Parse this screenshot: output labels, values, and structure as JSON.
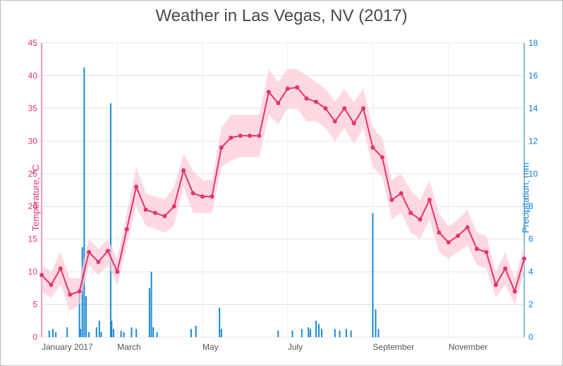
{
  "chart_data": {
    "type": "line+bar",
    "title": "Weather in Las Vegas, NV (2017)",
    "xlabel": "",
    "y_left_label": "Temperature, °C",
    "y_right_label": "Precipitation, mm",
    "y_left": {
      "min": 0,
      "max": 45,
      "step": 5,
      "color": "#e6326e"
    },
    "y_right": {
      "min": 0,
      "max": 18,
      "step": 2,
      "color": "#0f7bd1"
    },
    "x_ticks": [
      "January 2017",
      "March",
      "May",
      "July",
      "September",
      "November"
    ],
    "x_tick_week_index": [
      0,
      8,
      17,
      26,
      35,
      43
    ],
    "temperature_weekly": {
      "avg": [
        9.5,
        8.0,
        10.5,
        6.5,
        7.0,
        13.0,
        11.5,
        13.2,
        10.0,
        16.5,
        23.0,
        19.5,
        19.0,
        18.5,
        20.0,
        25.5,
        22.0,
        21.5,
        21.5,
        29.0,
        30.5,
        30.8,
        30.8,
        30.8,
        37.5,
        35.8,
        38.0,
        38.2,
        36.5,
        36.0,
        35.0,
        33.0,
        35.0,
        32.7,
        35.0,
        29.0,
        27.5,
        21.0,
        22.0,
        19.0,
        18.0,
        21.0,
        16.0,
        14.5,
        15.5,
        16.8,
        13.5,
        13.0,
        8.0,
        10.5,
        7.0,
        12.0
      ],
      "high": [
        11,
        10,
        13,
        9,
        9,
        15,
        13.5,
        15,
        12,
        19,
        26,
        22,
        21.5,
        21,
        23,
        28,
        25.5,
        24,
        24,
        32,
        34,
        34,
        34,
        34,
        41,
        39,
        41,
        41,
        40,
        39,
        38,
        36,
        38,
        36,
        38,
        32,
        30.5,
        24,
        25,
        22.5,
        21,
        24,
        19,
        17,
        18,
        19.5,
        16,
        15.5,
        10,
        13,
        9,
        14
      ],
      "low": [
        7,
        6,
        8,
        4,
        5,
        11,
        9.5,
        11,
        8,
        14,
        20,
        17,
        16.5,
        16,
        17,
        23,
        19,
        19,
        19,
        26,
        27,
        27.5,
        27.5,
        27.5,
        34,
        32.5,
        35,
        35,
        33,
        33,
        32,
        30,
        32,
        29.5,
        32,
        26,
        24.5,
        18,
        19,
        16,
        15,
        18,
        13,
        12,
        13,
        14,
        11,
        10.5,
        6,
        8,
        5,
        10
      ]
    },
    "precipitation_events": [
      [
        0.8,
        0.4
      ],
      [
        1.2,
        0.5
      ],
      [
        1.5,
        0.3
      ],
      [
        2.7,
        0.6
      ],
      [
        4.0,
        3.0
      ],
      [
        4.1,
        0.5
      ],
      [
        4.3,
        5.5
      ],
      [
        4.5,
        16.5
      ],
      [
        4.7,
        2.5
      ],
      [
        5.0,
        0.3
      ],
      [
        5.8,
        0.6
      ],
      [
        6.1,
        1.0
      ],
      [
        6.3,
        0.3
      ],
      [
        7.3,
        14.3
      ],
      [
        7.4,
        1.0
      ],
      [
        7.6,
        0.5
      ],
      [
        8.4,
        0.4
      ],
      [
        8.7,
        0.3
      ],
      [
        9.5,
        0.6
      ],
      [
        10.0,
        0.5
      ],
      [
        11.4,
        3.0
      ],
      [
        11.6,
        4.0
      ],
      [
        11.8,
        0.6
      ],
      [
        12.2,
        0.3
      ],
      [
        15.8,
        0.5
      ],
      [
        16.3,
        0.7
      ],
      [
        18.8,
        1.8
      ],
      [
        19.0,
        0.5
      ],
      [
        25.0,
        0.4
      ],
      [
        26.5,
        0.4
      ],
      [
        27.5,
        0.5
      ],
      [
        28.2,
        0.6
      ],
      [
        28.4,
        0.5
      ],
      [
        29.0,
        1.0
      ],
      [
        29.3,
        0.8
      ],
      [
        29.6,
        0.5
      ],
      [
        31.0,
        0.5
      ],
      [
        31.5,
        0.4
      ],
      [
        32.2,
        0.5
      ],
      [
        32.7,
        0.4
      ],
      [
        35.0,
        7.6
      ],
      [
        35.3,
        1.7
      ],
      [
        35.6,
        0.5
      ]
    ]
  }
}
